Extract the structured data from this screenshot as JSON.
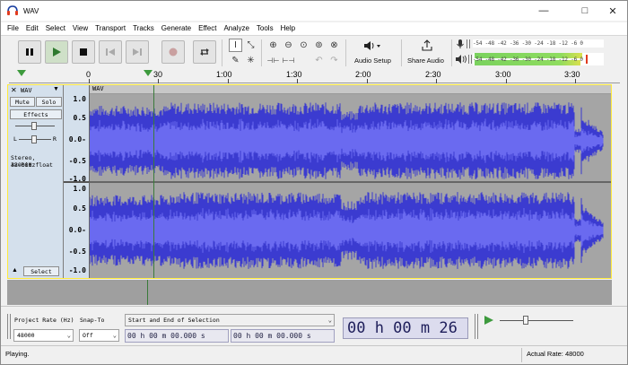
{
  "window": {
    "title": "WAV",
    "minimize": "—",
    "maximize": "□",
    "close": "✕"
  },
  "menu": [
    "File",
    "Edit",
    "Select",
    "View",
    "Transport",
    "Tracks",
    "Generate",
    "Effect",
    "Analyze",
    "Tools",
    "Help"
  ],
  "toolbar": {
    "audio_setup_label": "Audio Setup",
    "share_audio_label": "Share Audio",
    "meter_scale": "-54 -48 -42 -36 -30 -24 -18 -12 -6 0"
  },
  "ruler": {
    "ticks": [
      "0",
      "30",
      "1:00",
      "1:30",
      "2:00",
      "2:30",
      "3:00",
      "3:30"
    ]
  },
  "track": {
    "name": "WAV",
    "clip_name": "WAV",
    "mute_label": "Mute",
    "solo_label": "Solo",
    "effects_label": "Effects",
    "pan_left": "L",
    "pan_right": "R",
    "info_line1": "Stereo, 48000Hz",
    "info_line2": "32-bit float",
    "select_label": "Select",
    "scale": [
      "1.0",
      "0.5",
      "0.0-",
      "-0.5",
      "-1.0"
    ]
  },
  "selection_bar": {
    "project_rate_label": "Project Rate (Hz)",
    "project_rate_value": "48000",
    "snap_to_label": "Snap-To",
    "snap_to_value": "Off",
    "selection_mode": "Start and End of Selection",
    "start_time": "00 h 00 m 00.000 s",
    "end_time": "00 h 00 m 00.000 s",
    "audio_position": "00 h 00 m 26 s"
  },
  "status": {
    "state": "Playing.",
    "actual_rate": "Actual Rate: 48000"
  },
  "colors": {
    "waveform": "#3b3bd0",
    "waveform_light": "#6a6af0",
    "track_bg": "#a5a5a5",
    "panel_bg": "#d4e0ec",
    "selection_border": "#ffea3b",
    "playhead": "#3a7a3a"
  }
}
